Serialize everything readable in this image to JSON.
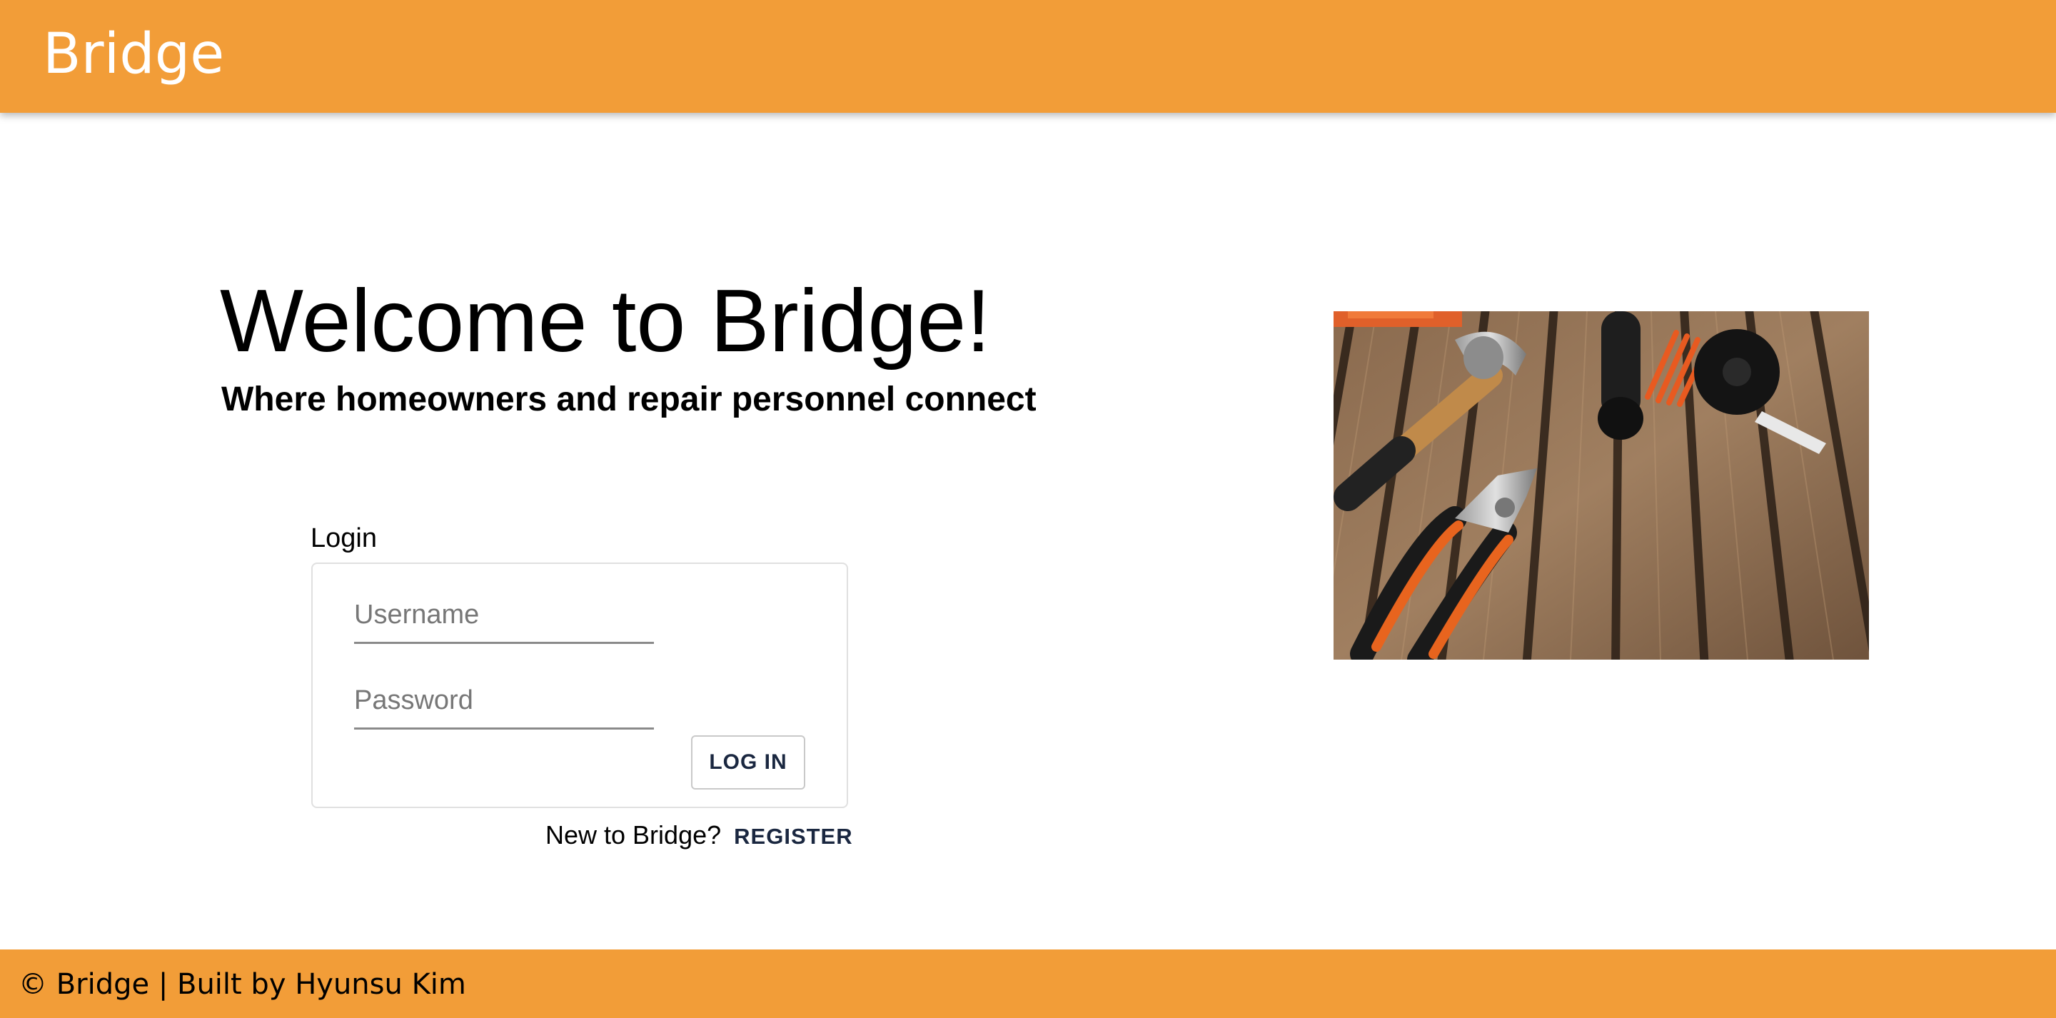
{
  "app_bar": {
    "brand": "Bridge",
    "color": "#f29d38"
  },
  "welcome": {
    "title": "Welcome to Bridge!",
    "subtitle": "Where homeowners and repair personnel connect"
  },
  "login": {
    "label": "Login",
    "username_placeholder": "Username",
    "password_placeholder": "Password",
    "button_label": "LOG IN"
  },
  "register": {
    "prompt": "New to Bridge?",
    "link_label": "REGISTER"
  },
  "hero_image": {
    "description": "tools-on-wooden-deck"
  },
  "footer": {
    "text": "© Bridge | Built by Hyunsu Kim"
  }
}
